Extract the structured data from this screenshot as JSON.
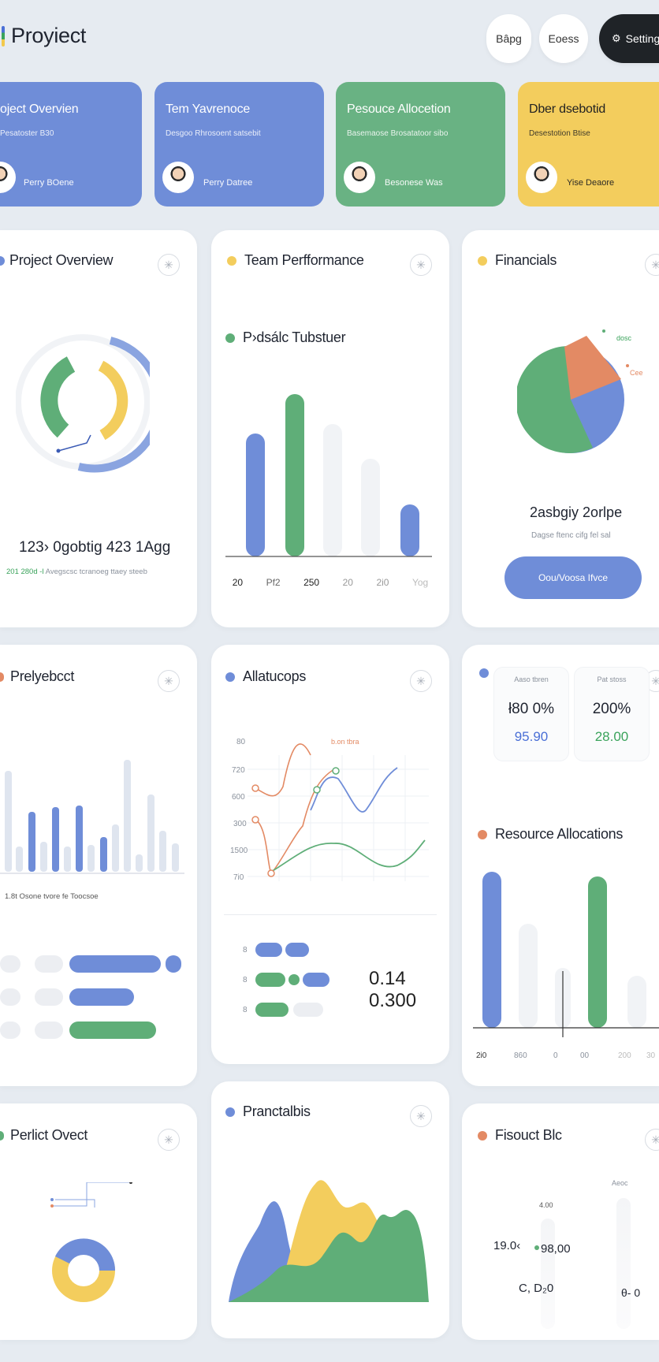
{
  "header": {
    "app_title": "Proyiect",
    "buttons": [
      "Bâpg",
      "Eoess",
      "Setting"
    ]
  },
  "tiles": [
    {
      "title": "oject Overvien",
      "sub": "Pesatoster B30",
      "name": "Perry BOene"
    },
    {
      "title": "Tem Yavrenoce",
      "sub": "Desgoo Rhrosoent satsebit",
      "name": "Perry Datree"
    },
    {
      "title": "Pesouce Allocetion",
      "sub": "Basemaose Brosatatoor sibo",
      "name": "Besonese Was"
    },
    {
      "title": "Dber dsebotid",
      "sub": "Desestotion Btise",
      "name": "Yise Deaore"
    }
  ],
  "cards": {
    "overview": {
      "title": "Project Overview",
      "stat": "123› 0gobtig 423 1Agg",
      "caption_green": "201 280d -l",
      "caption_rest": "Avegscsc tcranoeg ttaey steeb"
    },
    "team": {
      "title": "Team Perfformance",
      "legend": "P›dsálc Tubstuer",
      "ticks": [
        "20",
        "Pf2",
        "250",
        "20",
        "2i0",
        "Yog"
      ]
    },
    "financials": {
      "title": "Financials",
      "legend_a": "dosc",
      "legend_b": "Cee",
      "stat": "2asbgiy 2orlpe",
      "sub": "Dagse ftenc cifg fel sal",
      "button": "Oou/Voosa Ifvce"
    },
    "proj2": {
      "title": "Prelyebcct",
      "caption": "1.8t Osone tvore fe Toocsoe"
    },
    "alloc": {
      "title": "Allatucops",
      "line_label": "b.on tbra",
      "yticks": [
        "80",
        "720",
        "600",
        "300",
        "1500",
        "7i0"
      ],
      "value1": "0.14",
      "value2": "0.300",
      "row_labels": [
        "8",
        "8",
        "8"
      ]
    },
    "kpis": {
      "box1_label": "Aaso tbren",
      "box1_big": "ł80 0%",
      "box1_val": "95.90",
      "box2_label": "Pat stoss",
      "box2_big": "200%",
      "box2_val": "28.00"
    },
    "resource": {
      "title": "Resource Allocations",
      "ticks": [
        "2i0",
        "860",
        "0",
        "00",
        "200",
        "30"
      ]
    },
    "perfict": {
      "title": "Perlict Ovect"
    },
    "pranc": {
      "title": "Pranctalbis"
    },
    "fisouc": {
      "title": "Fisouct Blc",
      "top_label": "Aeoc",
      "mid_label": "4.00",
      "v1": "19.0‹",
      "v2": "98,00",
      "v3": "C, D₂0",
      "v4": "θ- 0"
    }
  },
  "colors": {
    "blue": "#6f8dd8",
    "green": "#5fae78",
    "yellow": "#f3cd5d",
    "orange": "#e38a64",
    "gray": "#e9ecf0"
  }
}
